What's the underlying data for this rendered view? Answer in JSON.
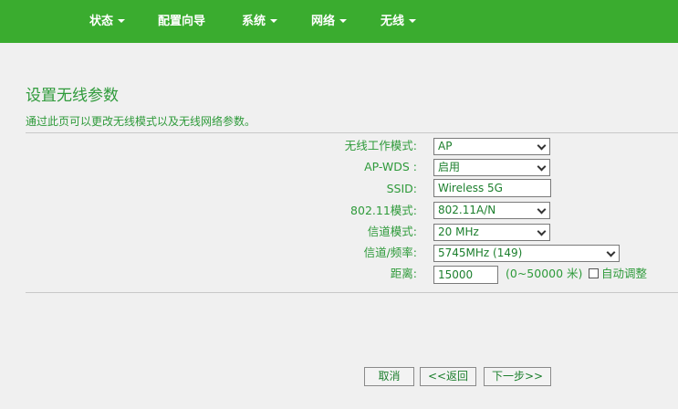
{
  "nav": {
    "items": [
      {
        "label": "状态",
        "has_caret": true
      },
      {
        "label": "配置向导",
        "has_caret": false
      },
      {
        "label": "系统",
        "has_caret": true
      },
      {
        "label": "网络",
        "has_caret": true
      },
      {
        "label": "无线",
        "has_caret": true
      }
    ]
  },
  "page": {
    "title": "设置无线参数",
    "description": "通过此页可以更改无线模式以及无线网络参数。"
  },
  "form": {
    "wireless_mode": {
      "label": "无线工作模式:",
      "value": "AP"
    },
    "ap_wds": {
      "label": "AP-WDS :",
      "value": "启用"
    },
    "ssid": {
      "label": "SSID:",
      "value": "Wireless 5G"
    },
    "mode_80211": {
      "label": "802.11模式:",
      "value": "802.11A/N"
    },
    "channel_mode": {
      "label": "信道模式:",
      "value": "20 MHz"
    },
    "channel_freq": {
      "label": "信道/频率:",
      "value": "5745MHz (149)"
    },
    "distance": {
      "label": "距离:",
      "value": "15000",
      "range_note": "(0~50000 米)",
      "auto_label": "自动调整",
      "auto_checked": false
    }
  },
  "buttons": {
    "cancel": "取消",
    "back": "<<返回",
    "next": "下一步>>"
  },
  "colors": {
    "nav_bg": "#3aac2f",
    "text_green": "#2e9a3a",
    "background": "#f0f0f0"
  }
}
